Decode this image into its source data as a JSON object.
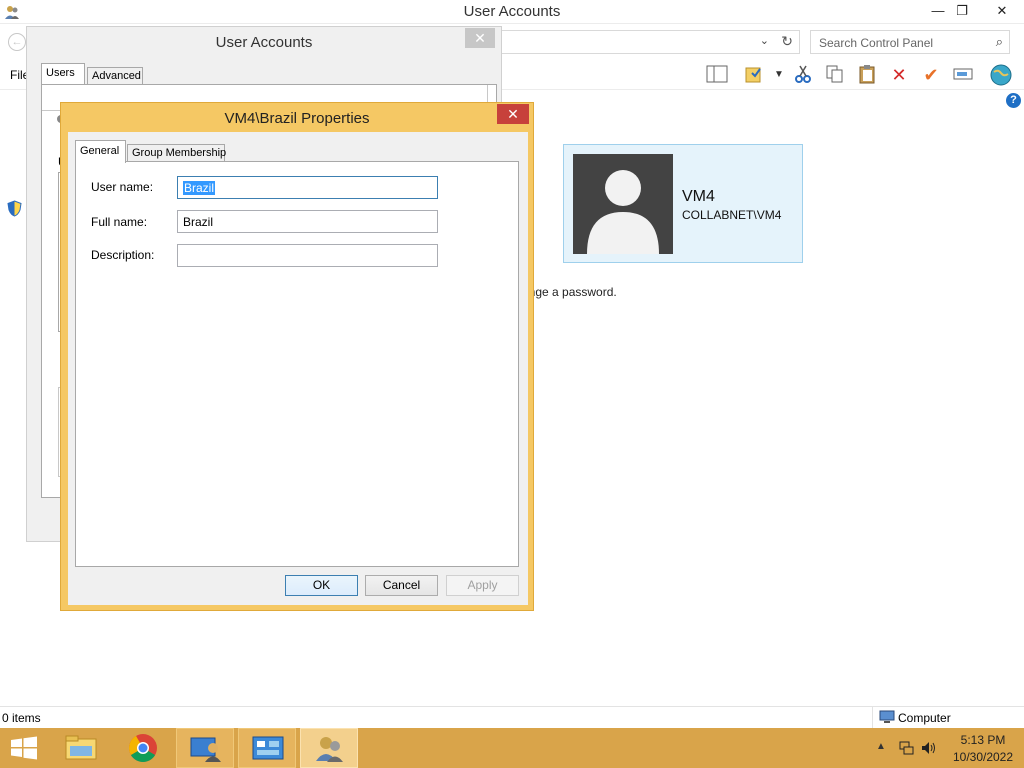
{
  "main_window": {
    "title": "User Accounts",
    "search_placeholder": "Search Control Panel",
    "menu_file": "File",
    "user_card": {
      "name": "VM4",
      "domain": "COLLABNET\\VM4"
    },
    "change_password_text": "ange a password.",
    "status_items": "0 items",
    "status_zone": "Computer"
  },
  "user_accounts_dialog": {
    "title": "User Accounts",
    "tabs": [
      {
        "label": "Users",
        "active": true
      },
      {
        "label": "Advanced",
        "active": false
      }
    ],
    "partial_letter": "U"
  },
  "properties_dialog": {
    "title": "VM4\\Brazil Properties",
    "tabs": [
      {
        "label": "General",
        "active": true
      },
      {
        "label": "Group Membership",
        "active": false
      }
    ],
    "fields": {
      "username_label": "User name:",
      "username_value": "Brazil",
      "fullname_label": "Full name:",
      "fullname_value": "Brazil",
      "description_label": "Description:",
      "description_value": ""
    },
    "buttons": {
      "ok": "OK",
      "cancel": "Cancel",
      "apply": "Apply"
    }
  },
  "taskbar": {
    "time": "5:13 PM",
    "date": "10/30/2022"
  },
  "colors": {
    "taskbar": "#d9a44a",
    "dialog_frame": "#f5c864",
    "close_red": "#c7413b",
    "selection": "#3399ff",
    "user_card_bg": "#e5f3fb"
  }
}
